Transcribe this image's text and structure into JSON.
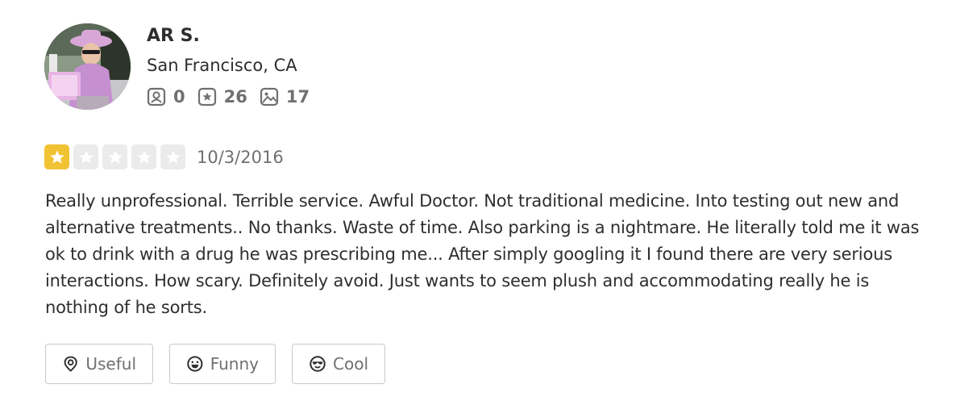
{
  "user": {
    "name": "AR S.",
    "location": "San Francisco, CA",
    "stats": {
      "friends": "0",
      "reviews": "26",
      "photos": "17"
    }
  },
  "review": {
    "rating": 1,
    "rating_max": 5,
    "date": "10/3/2016",
    "text": "Really unprofessional. Terrible service. Awful Doctor. Not traditional medicine. Into testing out new and alternative treatments.. No thanks. Waste of time. Also parking is a nightmare. He literally told me it was ok to drink with a drug he was prescribing me... After simply googling it I found there are very serious interactions. How scary. Definitely avoid. Just wants to seem plush and accommodating really he is nothing of he sorts."
  },
  "actions": {
    "useful_label": "Useful",
    "funny_label": "Funny",
    "cool_label": "Cool"
  },
  "colors": {
    "star_filled": "#f1c232",
    "star_empty": "#ebebeb",
    "text": "#2d2e2f",
    "muted": "#6e7072"
  },
  "icons": [
    "friends-icon",
    "reviews-icon",
    "photos-icon",
    "star-icon",
    "useful-icon",
    "funny-icon",
    "cool-icon"
  ]
}
